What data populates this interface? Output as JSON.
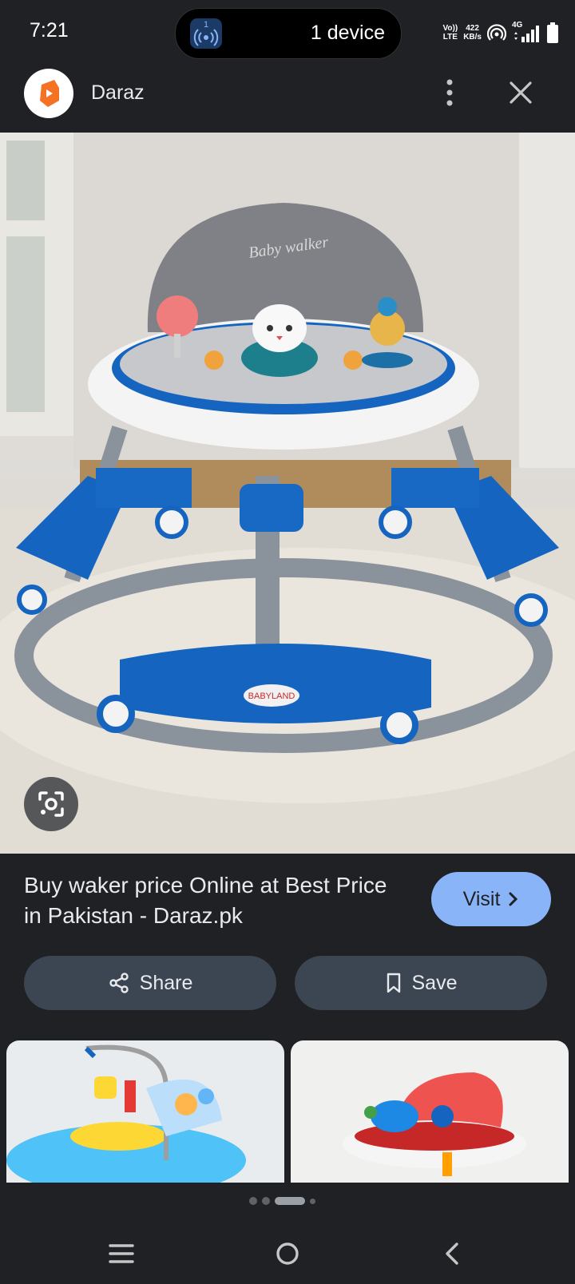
{
  "status_bar": {
    "time": "7:21",
    "cast_count": "1",
    "device_label": "1 device",
    "volte": [
      "Vo))",
      "LTE"
    ],
    "speed": [
      "422",
      "KB/s"
    ],
    "network": "4G",
    "icons": [
      "cast-icon",
      "hotspot-icon",
      "signal-icon",
      "battery-icon"
    ]
  },
  "app_bar": {
    "app_name": "Daraz",
    "icons": [
      "daraz-logo",
      "more-vert-icon",
      "close-icon"
    ]
  },
  "result": {
    "title": "Buy waker price Online at Best Price in Pakistan - Daraz.pk",
    "visit_label": "Visit",
    "share_label": "Share",
    "save_label": "Save",
    "image_text": "Baby walker",
    "image_brand": "BABYLAND"
  },
  "carousel": {
    "page_count": 4,
    "active_index": 2
  },
  "colors": {
    "background": "#1f2125",
    "accent": "#8ab4f8",
    "button_bg": "#3c4552",
    "walker_blue": "#1565c0"
  }
}
